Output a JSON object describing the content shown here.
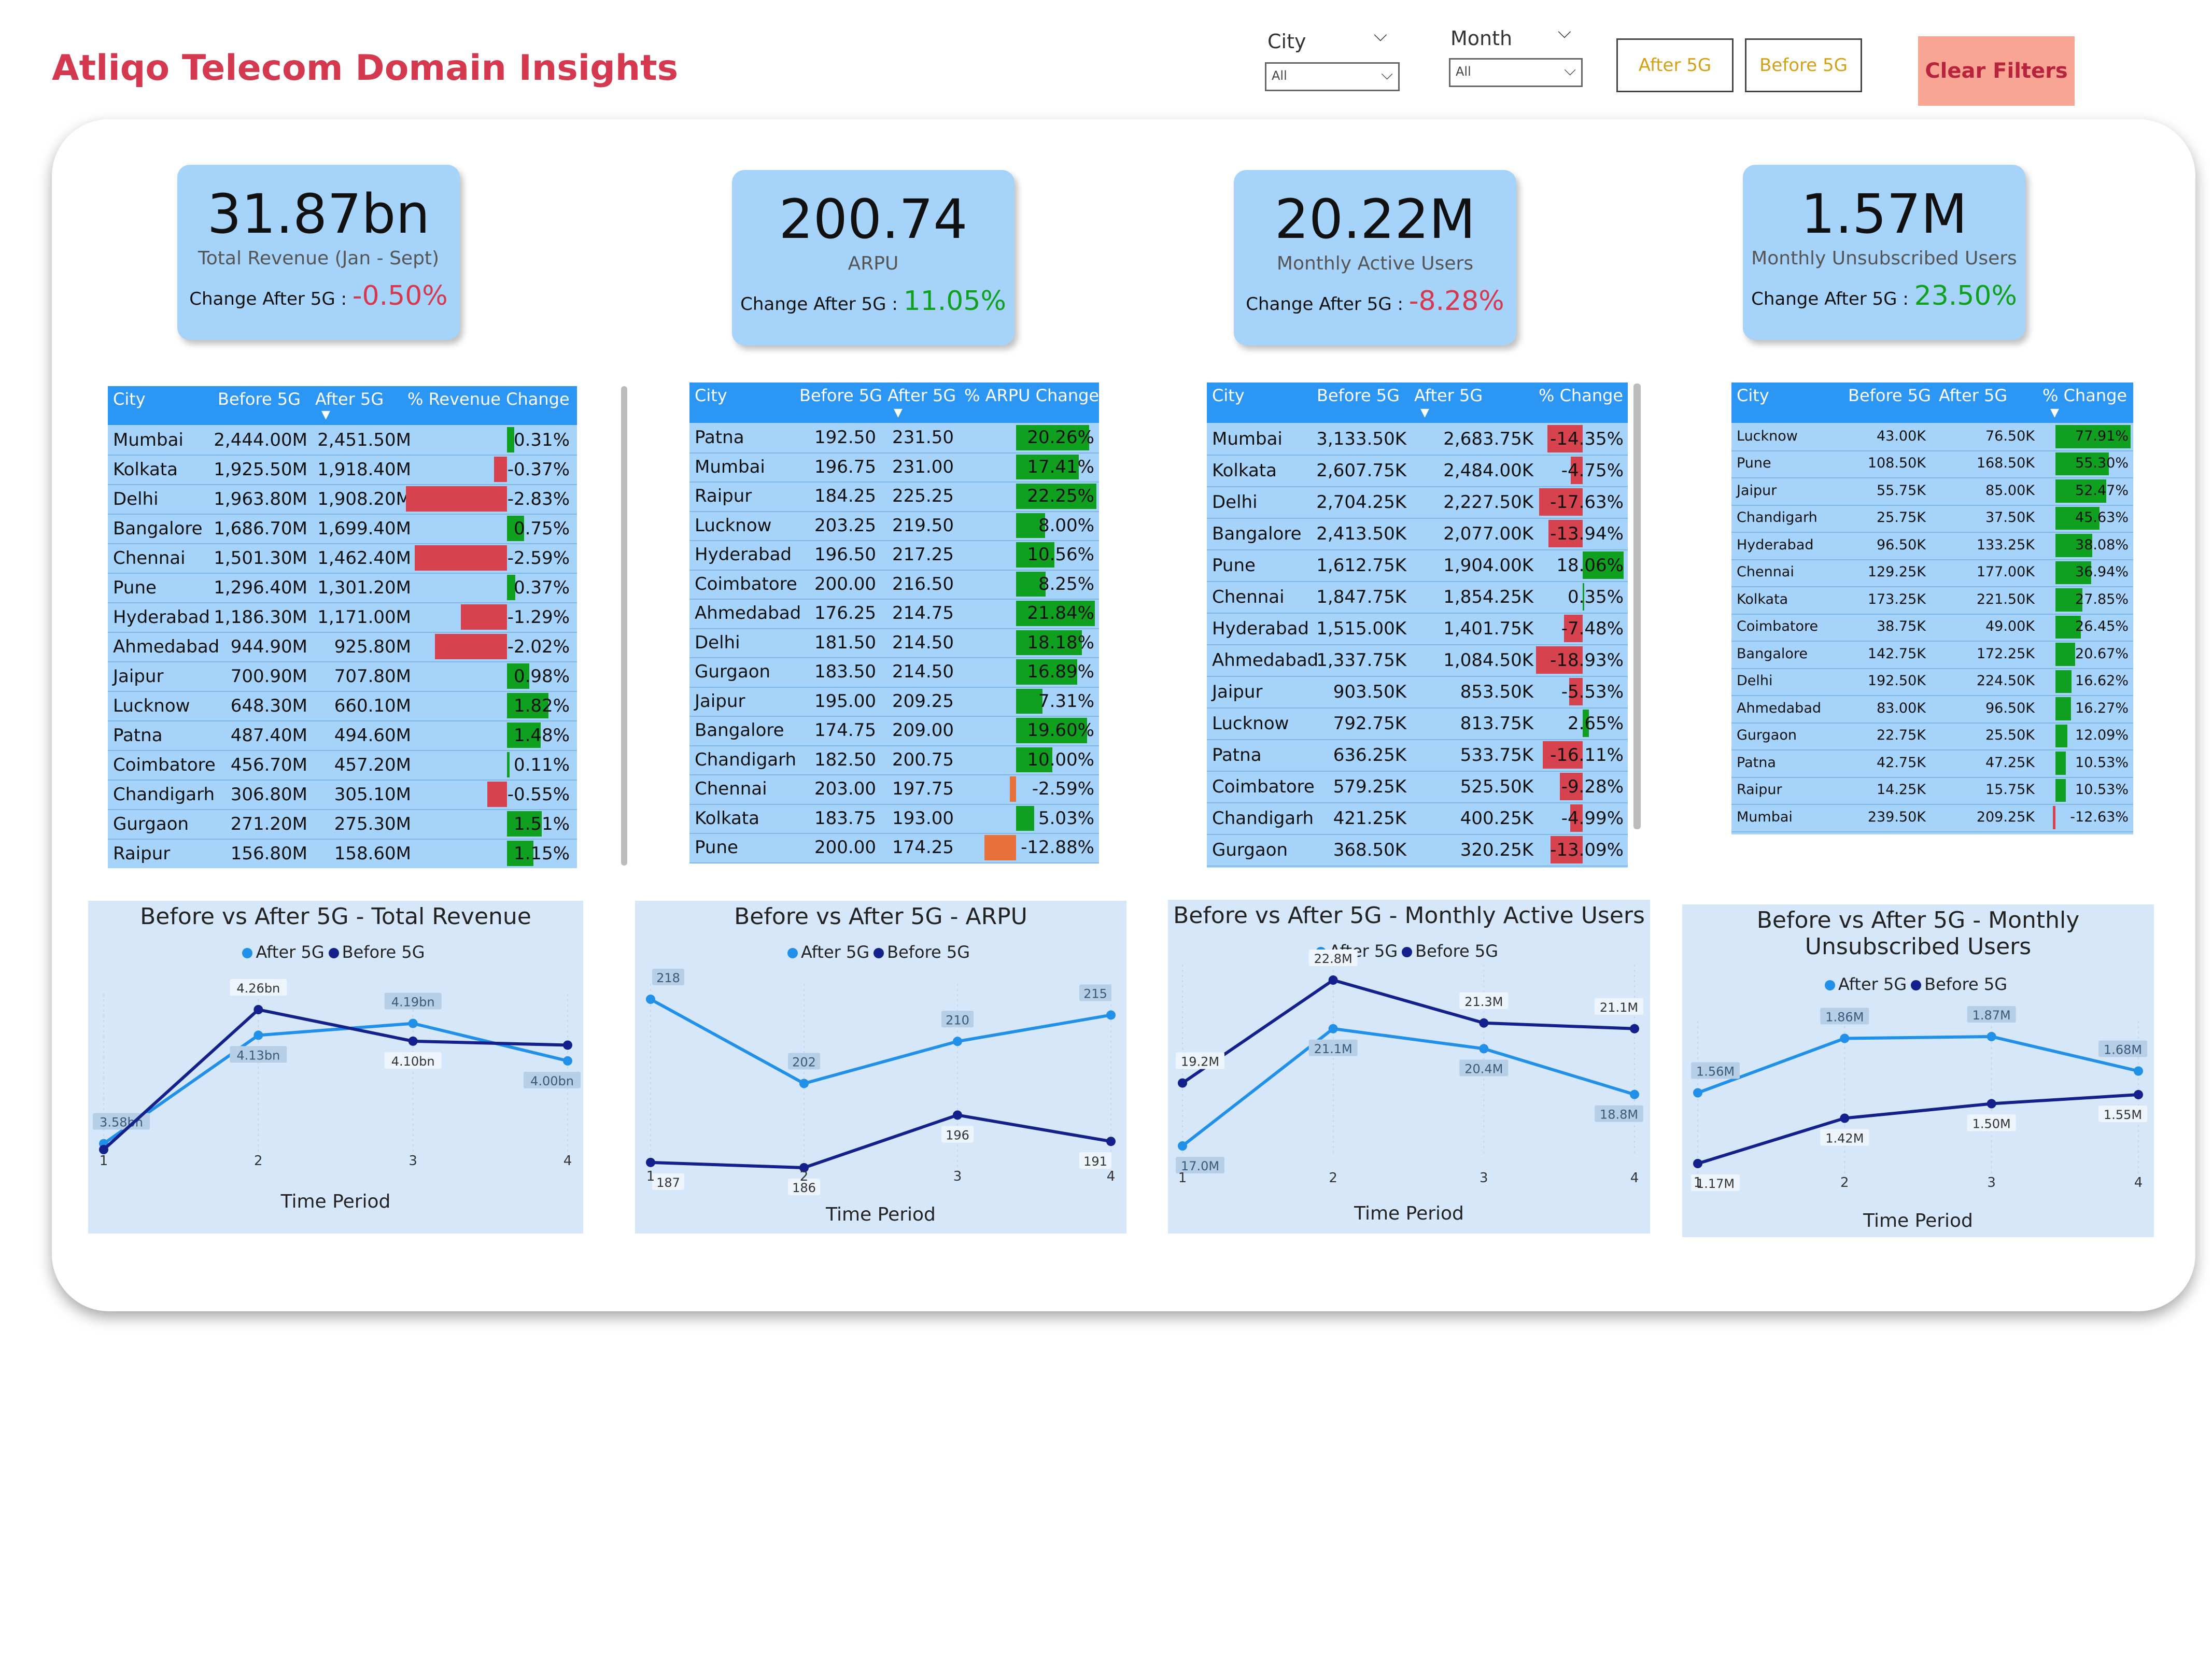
{
  "header": {
    "title": "Atliqo Telecom Domain Insights"
  },
  "filters": {
    "city": {
      "label": "City",
      "value": "All"
    },
    "month": {
      "label": "Month",
      "value": "All"
    },
    "after_btn": "After 5G",
    "before_btn": "Before 5G",
    "clear": "Clear Filters"
  },
  "colors": {
    "accent_red": "#d5394f",
    "kpi_bg": "#a6d3f9",
    "table_header": "#2b96f4",
    "positive": "#10a020",
    "negative": "#d6434f",
    "orange": "#e8703a",
    "after_line": "#2190e8",
    "before_line": "#14208c"
  },
  "kpis": [
    {
      "value": "31.87bn",
      "label": "Total Revenue (Jan - Sept)",
      "change_label": "Change After 5G :",
      "change": "-0.50%",
      "positive": false
    },
    {
      "value": "200.74",
      "label": "ARPU",
      "change_label": "Change After 5G :",
      "change": "11.05%",
      "positive": true
    },
    {
      "value": "20.22M",
      "label": "Monthly Active Users",
      "change_label": "Change After 5G :",
      "change": "-8.28%",
      "positive": false
    },
    {
      "value": "1.57M",
      "label": "Monthly Unsubscribed Users",
      "change_label": "Change After 5G :",
      "change": "23.50%",
      "positive": true
    }
  ],
  "tables": [
    {
      "headers": [
        "City",
        "Before 5G",
        "After 5G",
        "% Revenue Change"
      ],
      "max_abs": 2.83,
      "rows": [
        [
          "Mumbai",
          "2,444.00M",
          "2,451.50M",
          "0.31%",
          0.31
        ],
        [
          "Kolkata",
          "1,925.50M",
          "1,918.40M",
          "-0.37%",
          -0.37
        ],
        [
          "Delhi",
          "1,963.80M",
          "1,908.20M",
          "-2.83%",
          -2.83
        ],
        [
          "Bangalore",
          "1,686.70M",
          "1,699.40M",
          "0.75%",
          0.75
        ],
        [
          "Chennai",
          "1,501.30M",
          "1,462.40M",
          "-2.59%",
          -2.59
        ],
        [
          "Pune",
          "1,296.40M",
          "1,301.20M",
          "0.37%",
          0.37
        ],
        [
          "Hyderabad",
          "1,186.30M",
          "1,171.00M",
          "-1.29%",
          -1.29
        ],
        [
          "Ahmedabad",
          "944.90M",
          "925.80M",
          "-2.02%",
          -2.02
        ],
        [
          "Jaipur",
          "700.90M",
          "707.80M",
          "0.98%",
          0.98
        ],
        [
          "Lucknow",
          "648.30M",
          "660.10M",
          "1.82%",
          1.82
        ],
        [
          "Patna",
          "487.40M",
          "494.60M",
          "1.48%",
          1.48
        ],
        [
          "Coimbatore",
          "456.70M",
          "457.20M",
          "0.11%",
          0.11
        ],
        [
          "Chandigarh",
          "306.80M",
          "305.10M",
          "-0.55%",
          -0.55
        ],
        [
          "Gurgaon",
          "271.20M",
          "275.30M",
          "1.51%",
          1.51
        ],
        [
          "Raipur",
          "156.80M",
          "158.60M",
          "1.15%",
          1.15
        ]
      ]
    },
    {
      "headers": [
        "City",
        "Before 5G",
        "After 5G",
        "% ARPU Change"
      ],
      "max_abs": 22.25,
      "rows": [
        [
          "Patna",
          "192.50",
          "231.50",
          "20.26%",
          20.26
        ],
        [
          "Mumbai",
          "196.75",
          "231.00",
          "17.41%",
          17.41
        ],
        [
          "Raipur",
          "184.25",
          "225.25",
          "22.25%",
          22.25
        ],
        [
          "Lucknow",
          "203.25",
          "219.50",
          "8.00%",
          8.0
        ],
        [
          "Hyderabad",
          "196.50",
          "217.25",
          "10.56%",
          10.56
        ],
        [
          "Coimbatore",
          "200.00",
          "216.50",
          "8.25%",
          8.25
        ],
        [
          "Ahmedabad",
          "176.25",
          "214.75",
          "21.84%",
          21.84
        ],
        [
          "Delhi",
          "181.50",
          "214.50",
          "18.18%",
          18.18
        ],
        [
          "Gurgaon",
          "183.50",
          "214.50",
          "16.89%",
          16.89
        ],
        [
          "Jaipur",
          "195.00",
          "209.25",
          "7.31%",
          7.31
        ],
        [
          "Bangalore",
          "174.75",
          "209.00",
          "19.60%",
          19.6
        ],
        [
          "Chandigarh",
          "182.50",
          "200.75",
          "10.00%",
          10.0
        ],
        [
          "Chennai",
          "203.00",
          "197.75",
          "-2.59%",
          -2.59
        ],
        [
          "Kolkata",
          "183.75",
          "193.00",
          "5.03%",
          5.03
        ],
        [
          "Pune",
          "200.00",
          "174.25",
          "-12.88%",
          -12.88
        ]
      ]
    },
    {
      "headers": [
        "City",
        "Before 5G",
        "After 5G",
        "% Change"
      ],
      "max_abs": 18.93,
      "rows": [
        [
          "Mumbai",
          "3,133.50K",
          "2,683.75K",
          "-14.35%",
          -14.35
        ],
        [
          "Kolkata",
          "2,607.75K",
          "2,484.00K",
          "-4.75%",
          -4.75
        ],
        [
          "Delhi",
          "2,704.25K",
          "2,227.50K",
          "-17.63%",
          -17.63
        ],
        [
          "Bangalore",
          "2,413.50K",
          "2,077.00K",
          "-13.94%",
          -13.94
        ],
        [
          "Pune",
          "1,612.75K",
          "1,904.00K",
          "18.06%",
          18.06
        ],
        [
          "Chennai",
          "1,847.75K",
          "1,854.25K",
          "0.35%",
          0.35
        ],
        [
          "Hyderabad",
          "1,515.00K",
          "1,401.75K",
          "-7.48%",
          -7.48
        ],
        [
          "Ahmedabad",
          "1,337.75K",
          "1,084.50K",
          "-18.93%",
          -18.93
        ],
        [
          "Jaipur",
          "903.50K",
          "853.50K",
          "-5.53%",
          -5.53
        ],
        [
          "Lucknow",
          "792.75K",
          "813.75K",
          "2.65%",
          2.65
        ],
        [
          "Patna",
          "636.25K",
          "533.75K",
          "-16.11%",
          -16.11
        ],
        [
          "Coimbatore",
          "579.25K",
          "525.50K",
          "-9.28%",
          -9.28
        ],
        [
          "Chandigarh",
          "421.25K",
          "400.25K",
          "-4.99%",
          -4.99
        ],
        [
          "Gurgaon",
          "368.50K",
          "320.25K",
          "-13.09%",
          -13.09
        ]
      ]
    },
    {
      "headers": [
        "City",
        "Before 5G",
        "After 5G",
        "% Change"
      ],
      "max_abs": 77.91,
      "rows": [
        [
          "Lucknow",
          "43.00K",
          "76.50K",
          "77.91%",
          77.91
        ],
        [
          "Pune",
          "108.50K",
          "168.50K",
          "55.30%",
          55.3
        ],
        [
          "Jaipur",
          "55.75K",
          "85.00K",
          "52.47%",
          52.47
        ],
        [
          "Chandigarh",
          "25.75K",
          "37.50K",
          "45.63%",
          45.63
        ],
        [
          "Hyderabad",
          "96.50K",
          "133.25K",
          "38.08%",
          38.08
        ],
        [
          "Chennai",
          "129.25K",
          "177.00K",
          "36.94%",
          36.94
        ],
        [
          "Kolkata",
          "173.25K",
          "221.50K",
          "27.85%",
          27.85
        ],
        [
          "Coimbatore",
          "38.75K",
          "49.00K",
          "26.45%",
          26.45
        ],
        [
          "Bangalore",
          "142.75K",
          "172.25K",
          "20.67%",
          20.67
        ],
        [
          "Delhi",
          "192.50K",
          "224.50K",
          "16.62%",
          16.62
        ],
        [
          "Ahmedabad",
          "83.00K",
          "96.50K",
          "16.27%",
          16.27
        ],
        [
          "Gurgaon",
          "22.75K",
          "25.50K",
          "12.09%",
          12.09
        ],
        [
          "Patna",
          "42.75K",
          "47.25K",
          "10.53%",
          10.53
        ],
        [
          "Raipur",
          "14.25K",
          "15.75K",
          "10.53%",
          10.53
        ],
        [
          "Mumbai",
          "239.50K",
          "209.25K",
          "-12.63%",
          -12.63
        ]
      ]
    }
  ],
  "chart_data": [
    {
      "type": "line",
      "title": "Before vs After 5G - Total Revenue",
      "xlabel": "Time Period",
      "ylabel": "",
      "x": [
        1,
        2,
        3,
        4
      ],
      "series": [
        {
          "name": "After 5G",
          "values": [
            3.58,
            4.13,
            4.19,
            4.0
          ],
          "labels": [
            "3.58bn",
            "4.13bn",
            "4.19bn",
            "4.00bn"
          ]
        },
        {
          "name": "Before 5G",
          "values": [
            3.55,
            4.26,
            4.1,
            4.08
          ],
          "labels": [
            "",
            "4.26bn",
            "4.10bn",
            ""
          ]
        }
      ]
    },
    {
      "type": "line",
      "title": "Before vs After 5G - ARPU",
      "xlabel": "Time Period",
      "ylabel": "",
      "x": [
        1,
        2,
        3,
        4
      ],
      "series": [
        {
          "name": "After 5G",
          "values": [
            218,
            202,
            210,
            215
          ],
          "labels": [
            "218",
            "202",
            "210",
            "215"
          ]
        },
        {
          "name": "Before 5G",
          "values": [
            187,
            186,
            196,
            191
          ],
          "labels": [
            "187",
            "186",
            "196",
            "191"
          ]
        }
      ]
    },
    {
      "type": "line",
      "title": "Before vs After 5G - Monthly Active Users",
      "xlabel": "Time Period",
      "ylabel": "",
      "x": [
        1,
        2,
        3,
        4
      ],
      "series": [
        {
          "name": "After 5G",
          "values": [
            17.0,
            21.1,
            20.4,
            18.8
          ],
          "labels": [
            "17.0M",
            "21.1M",
            "20.4M",
            "18.8M"
          ]
        },
        {
          "name": "Before 5G",
          "values": [
            19.2,
            22.8,
            21.3,
            21.1
          ],
          "labels": [
            "19.2M",
            "22.8M",
            "21.3M",
            "21.1M"
          ]
        }
      ]
    },
    {
      "type": "line",
      "title": "Before vs After 5G - Monthly Unsubscribed Users",
      "xlabel": "Time Period",
      "ylabel": "",
      "x": [
        1,
        2,
        3,
        4
      ],
      "series": [
        {
          "name": "After 5G",
          "values": [
            1.56,
            1.86,
            1.87,
            1.68
          ],
          "labels": [
            "1.56M",
            "1.86M",
            "1.87M",
            "1.68M"
          ]
        },
        {
          "name": "Before 5G",
          "values": [
            1.17,
            1.42,
            1.5,
            1.55
          ],
          "labels": [
            "1.17M",
            "1.42M",
            "1.50M",
            "1.55M"
          ]
        }
      ]
    }
  ]
}
